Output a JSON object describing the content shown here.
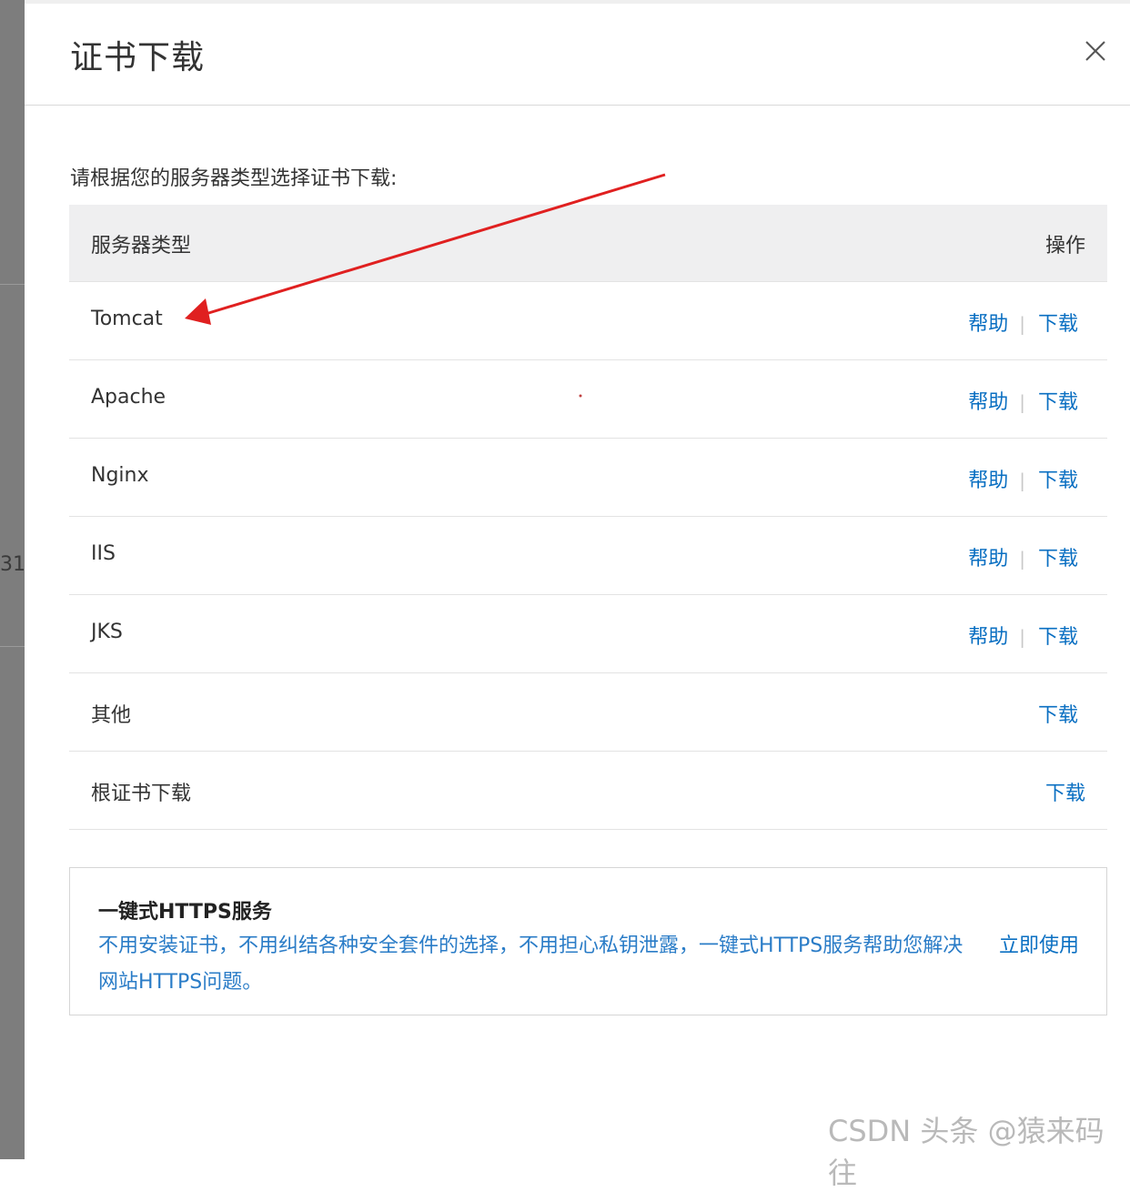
{
  "dialog": {
    "title": "证书下载",
    "close_icon": "close-icon"
  },
  "subtitle": "请根据您的服务器类型选择证书下载:",
  "table": {
    "headers": {
      "server_type": "服务器类型",
      "actions": "操作"
    },
    "rows": [
      {
        "name": "Tomcat",
        "help": "帮助",
        "download": "下载"
      },
      {
        "name": "Apache",
        "help": "帮助",
        "download": "下载"
      },
      {
        "name": "Nginx",
        "help": "帮助",
        "download": "下载"
      },
      {
        "name": "IIS",
        "help": "帮助",
        "download": "下载"
      },
      {
        "name": "JKS",
        "help": "帮助",
        "download": "下载"
      },
      {
        "name": "其他",
        "download": "下载"
      },
      {
        "name": "根证书下载",
        "download": "下载"
      }
    ],
    "separator": "|"
  },
  "promo": {
    "title": "一键式HTTPS服务",
    "description": "不用安装证书，不用纠结各种安全套件的选择，不用担心私钥泄露，一键式HTTPS服务帮助您解决网站HTTPS问题。",
    "cta": "立即使用"
  },
  "backdrop_fragment": "31",
  "watermark": "CSDN 头条 @猿来码往",
  "colors": {
    "link": "#0a6fc2",
    "promo_text": "#2a7cc7",
    "annotation_arrow": "#e02020"
  }
}
